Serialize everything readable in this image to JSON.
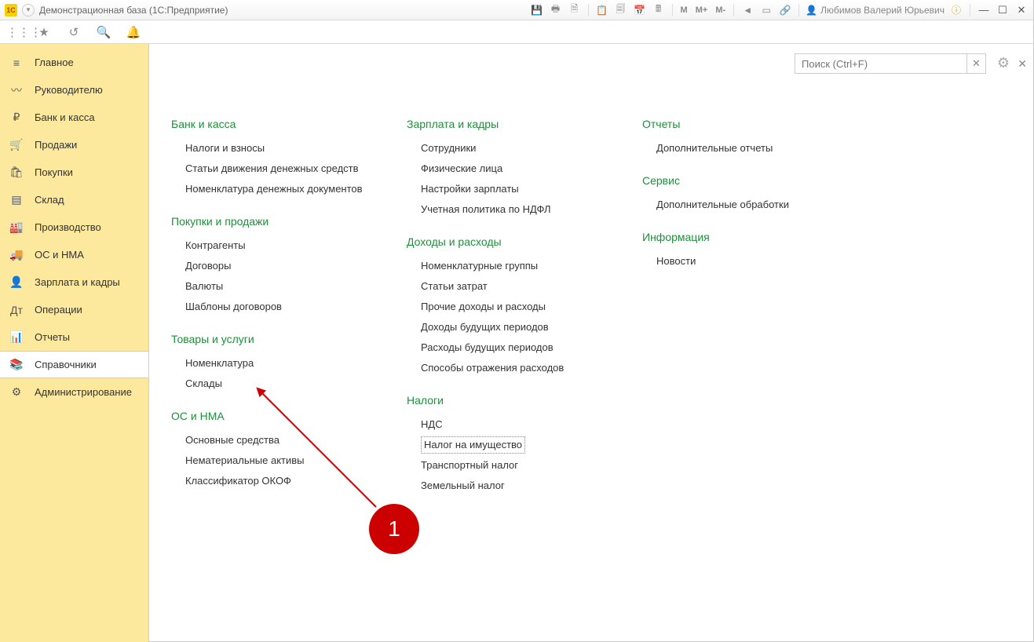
{
  "title": "Демонстрационная база  (1С:Предприятие)",
  "user_name": "Любимов Валерий Юрьевич",
  "search": {
    "placeholder": "Поиск (Ctrl+F)"
  },
  "toolbar_m": {
    "m": "М",
    "mplus": "М+",
    "mminus": "М-"
  },
  "sidebar": {
    "items": [
      {
        "icon": "≡",
        "label": "Главное",
        "name": "main"
      },
      {
        "icon": "〰",
        "label": "Руководителю",
        "name": "manager"
      },
      {
        "icon": "₽",
        "label": "Банк и касса",
        "name": "bank"
      },
      {
        "icon": "🛒",
        "label": "Продажи",
        "name": "sales"
      },
      {
        "icon": "🛍",
        "label": "Покупки",
        "name": "purchases"
      },
      {
        "icon": "▤",
        "label": "Склад",
        "name": "warehouse"
      },
      {
        "icon": "🏭",
        "label": "Производство",
        "name": "production"
      },
      {
        "icon": "🚚",
        "label": "ОС и НМА",
        "name": "assets"
      },
      {
        "icon": "👤",
        "label": "Зарплата и кадры",
        "name": "hr"
      },
      {
        "icon": "Дт",
        "label": "Операции",
        "name": "operations"
      },
      {
        "icon": "📊",
        "label": "Отчеты",
        "name": "reports"
      },
      {
        "icon": "📚",
        "label": "Справочники",
        "name": "directories"
      },
      {
        "icon": "⚙",
        "label": "Администрирование",
        "name": "admin"
      }
    ],
    "active_index": 11
  },
  "columns": [
    [
      {
        "title": "Банк и касса",
        "items": [
          "Налоги и взносы",
          "Статьи движения денежных средств",
          "Номенклатура денежных документов"
        ]
      },
      {
        "title": "Покупки и продажи",
        "items": [
          "Контрагенты",
          "Договоры",
          "Валюты",
          "Шаблоны договоров"
        ]
      },
      {
        "title": "Товары и услуги",
        "items": [
          "Номенклатура",
          "Склады"
        ]
      },
      {
        "title": "ОС и НМА",
        "items": [
          "Основные средства",
          "Нематериальные активы",
          "Классификатор ОКОФ"
        ]
      }
    ],
    [
      {
        "title": "Зарплата и кадры",
        "items": [
          "Сотрудники",
          "Физические лица",
          "Настройки зарплаты",
          "Учетная политика по НДФЛ"
        ]
      },
      {
        "title": "Доходы и расходы",
        "items": [
          "Номенклатурные группы",
          "Статьи затрат",
          "Прочие доходы и расходы",
          "Доходы будущих периодов",
          "Расходы будущих периодов",
          "Способы отражения расходов"
        ]
      },
      {
        "title": "Налоги",
        "items": [
          "НДС",
          "Налог на имущество",
          "Транспортный налог",
          "Земельный налог"
        ],
        "boxed_index": 1
      }
    ],
    [
      {
        "title": "Отчеты",
        "items": [
          "Дополнительные отчеты"
        ]
      },
      {
        "title": "Сервис",
        "items": [
          "Дополнительные обработки"
        ]
      },
      {
        "title": "Информация",
        "items": [
          "Новости"
        ]
      }
    ]
  ],
  "annotation": {
    "badge": "1"
  }
}
